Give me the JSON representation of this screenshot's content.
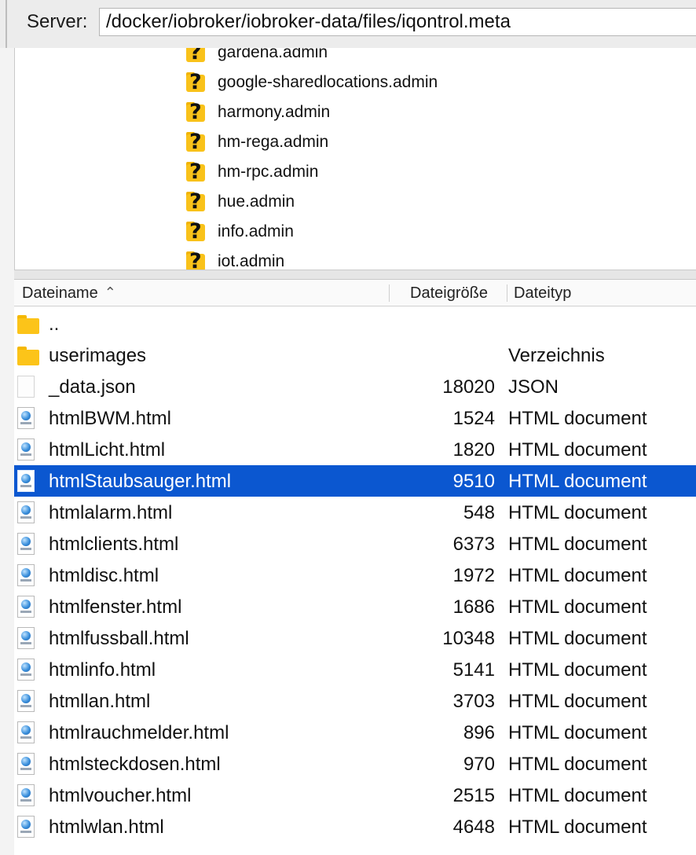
{
  "path_bar": {
    "label": "Server:",
    "path": "/docker/iobroker/iobroker-data/files/iqontrol.meta"
  },
  "tree": {
    "items": [
      {
        "label": "gardena.admin",
        "icon": "unknown-folder-icon"
      },
      {
        "label": "google-sharedlocations.admin",
        "icon": "unknown-folder-icon"
      },
      {
        "label": "harmony.admin",
        "icon": "unknown-folder-icon"
      },
      {
        "label": "hm-rega.admin",
        "icon": "unknown-folder-icon"
      },
      {
        "label": "hm-rpc.admin",
        "icon": "unknown-folder-icon"
      },
      {
        "label": "hue.admin",
        "icon": "unknown-folder-icon"
      },
      {
        "label": "info.admin",
        "icon": "unknown-folder-icon"
      },
      {
        "label": "iot.admin",
        "icon": "unknown-folder-icon"
      }
    ]
  },
  "list_header": {
    "col_name": "Dateiname",
    "col_size": "Dateigröße",
    "col_type": "Dateityp",
    "sort_icon": "chevron-up-icon"
  },
  "files": [
    {
      "name": "..",
      "size": "",
      "type": "",
      "icon": "folder-icon",
      "selected": false
    },
    {
      "name": "userimages",
      "size": "",
      "type": "Verzeichnis",
      "icon": "folder-icon",
      "selected": false
    },
    {
      "name": "_data.json",
      "size": "18020",
      "type": "JSON",
      "icon": "file-icon",
      "selected": false
    },
    {
      "name": "htmlBWM.html",
      "size": "1524",
      "type": "HTML document",
      "icon": "html-file-icon",
      "selected": false
    },
    {
      "name": "htmlLicht.html",
      "size": "1820",
      "type": "HTML document",
      "icon": "html-file-icon",
      "selected": false
    },
    {
      "name": "htmlStaubsauger.html",
      "size": "9510",
      "type": "HTML document",
      "icon": "html-file-icon",
      "selected": true
    },
    {
      "name": "htmlalarm.html",
      "size": "548",
      "type": "HTML document",
      "icon": "html-file-icon",
      "selected": false
    },
    {
      "name": "htmlclients.html",
      "size": "6373",
      "type": "HTML document",
      "icon": "html-file-icon",
      "selected": false
    },
    {
      "name": "htmldisc.html",
      "size": "1972",
      "type": "HTML document",
      "icon": "html-file-icon",
      "selected": false
    },
    {
      "name": "htmlfenster.html",
      "size": "1686",
      "type": "HTML document",
      "icon": "html-file-icon",
      "selected": false
    },
    {
      "name": "htmlfussball.html",
      "size": "10348",
      "type": "HTML document",
      "icon": "html-file-icon",
      "selected": false
    },
    {
      "name": "htmlinfo.html",
      "size": "5141",
      "type": "HTML document",
      "icon": "html-file-icon",
      "selected": false
    },
    {
      "name": "htmllan.html",
      "size": "3703",
      "type": "HTML document",
      "icon": "html-file-icon",
      "selected": false
    },
    {
      "name": "htmlrauchmelder.html",
      "size": "896",
      "type": "HTML document",
      "icon": "html-file-icon",
      "selected": false
    },
    {
      "name": "htmlsteckdosen.html",
      "size": "970",
      "type": "HTML document",
      "icon": "html-file-icon",
      "selected": false
    },
    {
      "name": "htmlvoucher.html",
      "size": "2515",
      "type": "HTML document",
      "icon": "html-file-icon",
      "selected": false
    },
    {
      "name": "htmlwlan.html",
      "size": "4648",
      "type": "HTML document",
      "icon": "html-file-icon",
      "selected": false
    }
  ],
  "colors": {
    "selection": "#0b57d0",
    "folder": "#fcc419"
  }
}
